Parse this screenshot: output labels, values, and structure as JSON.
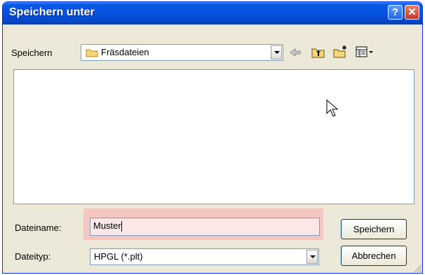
{
  "window": {
    "title": "Speichern unter"
  },
  "location": {
    "label": "Speichern",
    "folder": "Fräsdateien"
  },
  "toolbar": {
    "icons": [
      "back-icon",
      "up-folder-icon",
      "new-folder-icon",
      "view-menu-icon"
    ]
  },
  "filename": {
    "label": "Dateiname:",
    "value": "Muster"
  },
  "filetype": {
    "label": "Dateityp:",
    "value": "HPGL (*.plt)"
  },
  "buttons": {
    "save": "Speichern",
    "cancel": "Abbrechen"
  },
  "colors": {
    "titlebar": "#0551e0",
    "highlight": "#f4c7c3",
    "face": "#ece9d8"
  }
}
